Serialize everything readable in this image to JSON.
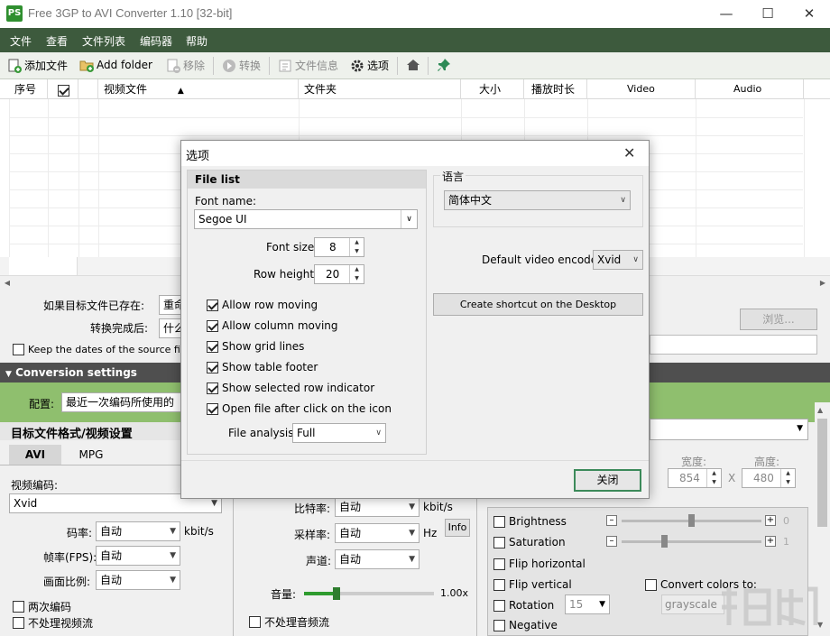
{
  "window": {
    "title": "Free 3GP to AVI Converter 1.10  [32-bit]",
    "icon_text": "PS",
    "controls": [
      "minimize-icon",
      "maximize-icon",
      "close-icon"
    ]
  },
  "menu": [
    "文件",
    "查看",
    "文件列表",
    "编码器",
    "帮助"
  ],
  "toolbar": {
    "add_file": "添加文件",
    "add_folder": "Add folder",
    "remove": "移除",
    "convert": "转换",
    "file_info": "文件信息",
    "options": "选项"
  },
  "grid": {
    "columns": [
      "序号",
      "",
      "视频文件",
      "文件夹",
      "大小",
      "播放时长",
      "Video",
      "Audio"
    ]
  },
  "settings": {
    "if_exists_label": "如果目标文件已存在:",
    "if_exists_value": "重命",
    "after_convert_label": "转换完成后:",
    "after_convert_value": "什么",
    "keep_dates": "Keep the dates of the source files",
    "browse": "浏览...",
    "conversion_settings": "Conversion settings",
    "profile_label": "配置:",
    "profile_value": "最近一次编码所使用的",
    "target_format": "目标文件格式/视频设置",
    "tabs": [
      "AVI",
      "MPG"
    ],
    "video_codec_label": "视频编码:",
    "video_codec_value": "Xvid",
    "bitrate_label": "码率:",
    "bitrate_value": "自动",
    "bitrate_unit": "kbit/s",
    "fps_label": "帧率(FPS):",
    "fps_value": "自动",
    "aspect_label": "画面比例:",
    "aspect_value": "自动",
    "two_pass": "两次编码",
    "no_video": "不处理视频流",
    "audio_bitrate_label": "比特率:",
    "audio_bitrate_value": "自动",
    "audio_bitrate_unit": "kbit/s",
    "samplerate_label": "采样率:",
    "samplerate_value": "自动",
    "samplerate_unit": "Hz",
    "info_button": "Info",
    "channels_label": "声道:",
    "channels_value": "自动",
    "volume_label": "音量:",
    "volume_value": "1.00x",
    "volume_level": 0.25,
    "no_audio": "不处理音频流",
    "width_label": "宽度:",
    "width_value": "854",
    "height_label": "高度:",
    "height_value": "480",
    "x_sep": "X",
    "brightness": "Brightness",
    "brightness_value": "0",
    "saturation": "Saturation",
    "saturation_value": "1",
    "flip_h": "Flip horizontal",
    "flip_v": "Flip vertical",
    "rotation": "Rotation",
    "rotation_value": "15",
    "negative": "Negative",
    "convert_colors": "Convert colors to:",
    "convert_colors_value": "grayscale"
  },
  "dialog": {
    "title": "选项",
    "file_list_header": "File list",
    "font_name_label": "Font name:",
    "font_name_value": "Segoe UI",
    "font_size_label": "Font size:",
    "font_size_value": "8",
    "row_height_label": "Row height:",
    "row_height_value": "20",
    "options": [
      {
        "label": "Allow row moving",
        "checked": true
      },
      {
        "label": "Allow column moving",
        "checked": true
      },
      {
        "label": "Show grid lines",
        "checked": true
      },
      {
        "label": "Show table footer",
        "checked": true
      },
      {
        "label": "Show selected row indicator",
        "checked": true
      },
      {
        "label": "Open file after click on the icon",
        "checked": true
      }
    ],
    "file_analysis_label": "File analysis:",
    "file_analysis_value": "Full",
    "language_label": "语言",
    "language_value": "简体中文",
    "default_encoder_label": "Default video encoder:",
    "default_encoder_value": "Xvid",
    "shortcut_button": "Create shortcut on the Desktop",
    "close_button": "关闭"
  },
  "colors": {
    "menubar": "#3d5a3d",
    "accent_green": "#8fbf6e",
    "section_bar": "#4f4f4f"
  }
}
